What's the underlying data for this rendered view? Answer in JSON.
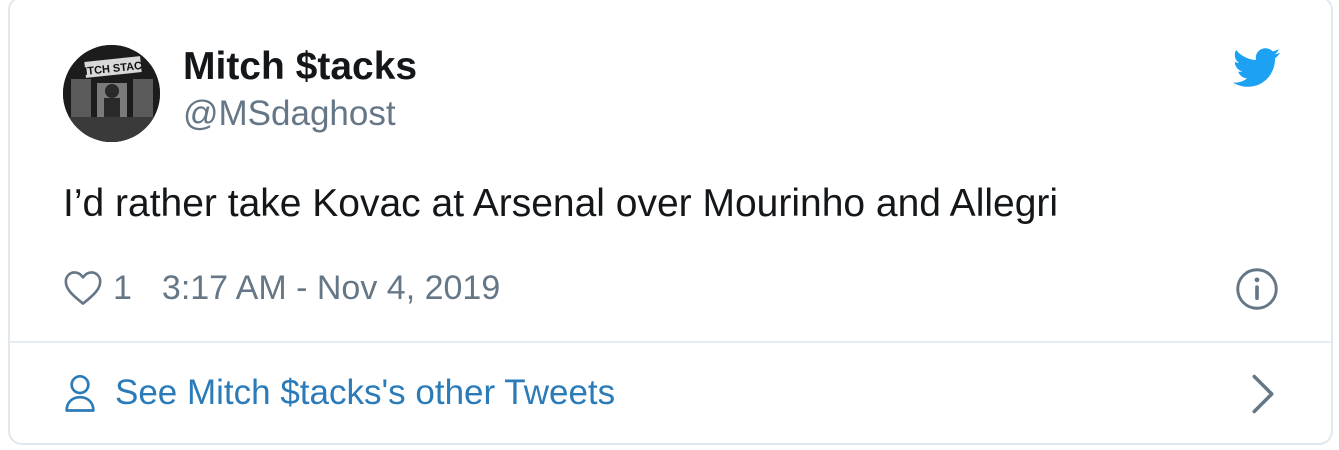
{
  "author": {
    "name": "Mitch $tacks",
    "handle": "@MSdaghost",
    "avatar_sign_text": "ITCH STAC"
  },
  "brand_icon": "twitter-bird-icon",
  "tweet": {
    "text": "I’d rather take Kovac at Arsenal over Mourinho and Allegri",
    "like_count": "1",
    "timestamp": "3:17 AM - Nov 4, 2019"
  },
  "footer": {
    "link_text": "See Mitch $tacks's other Tweets"
  },
  "icons": {
    "like": "heart-icon",
    "info": "info-icon",
    "profile": "person-icon",
    "navigate": "chevron-right-icon"
  },
  "colors": {
    "twitter_blue": "#1da1f2",
    "link_blue": "#2b7bb9",
    "text": "#14171a",
    "muted": "#657786",
    "border": "#e1e8ed"
  }
}
